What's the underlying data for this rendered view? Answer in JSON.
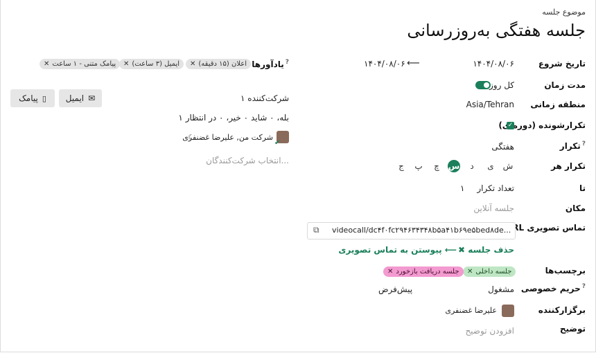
{
  "header": {
    "subject_label": "موضوع جلسه",
    "title": "جلسه هفتگی به‌روزرسانی"
  },
  "fields": {
    "start_label": "تاریخ شروع",
    "start_date": "۱۴۰۴/۰۸/۰۶",
    "end_date": "۱۴۰۴/۰۸/۰۶",
    "duration_label": "مدت زمان",
    "all_day_label": "کل روز",
    "timezone_label": "منطقه زمانی",
    "timezone_value": "Asia/Tehran",
    "recurrent_label": "تکرارشونده (دوره‌ای)",
    "repeat_label": "تکرار",
    "repeat_value": "هفتگی",
    "repeat_on_label": "تکرار هر",
    "days": [
      "ش",
      "ی",
      "د",
      "س",
      "چ",
      "پ",
      "ج"
    ],
    "selected_day": "س",
    "until_label": "تا",
    "count_label": "تعداد تکرار",
    "count_value": "۱",
    "location_label": "مکان",
    "location_placeholder": "جلسه آنلاین",
    "videocall_label": "URL تماس تصویری",
    "videocall_url": "videocall/dc۴f۰fc۲۹۴۶۳۴۳۴۸b۵a۴۱b۶۹e۵bed۸de...",
    "delete_meeting": "حذف جلسه",
    "join_video": "پیوستن به تماس تصویری",
    "tags_label": "برچسب‌ها",
    "tags": [
      "جلسه داخلی",
      "جلسه دریافت بازخورد"
    ],
    "privacy_label": "حریم خصوصی",
    "privacy_value": "پیش‌فرض",
    "show_as_value": "مشغول",
    "organizer_label": "برگزارکننده",
    "organizer_name": "علیرضا غضنفری",
    "description_label": "توضیح",
    "description_placeholder": "افزودن توضیح"
  },
  "reminders": {
    "label": "یادآورها",
    "items": [
      "اعلان (۱۵ دقیقه)",
      "ایمیل (۳ ساعت)",
      "پیامک متنی - ۱ ساعت"
    ]
  },
  "attendees": {
    "count_text": "۱ شرکت‌کننده",
    "summary_text": "۱ بله، ۰ شاید ۰ خیر، ۰ در انتظار",
    "person_text": "شرکت من, علیرضا غضنفری",
    "select_placeholder": "انتخاب شرکت‌کنندگان...",
    "email_button": "ایمیل",
    "sms_button": "پیامک"
  },
  "colors": {
    "accent": "#1a7f5a"
  }
}
